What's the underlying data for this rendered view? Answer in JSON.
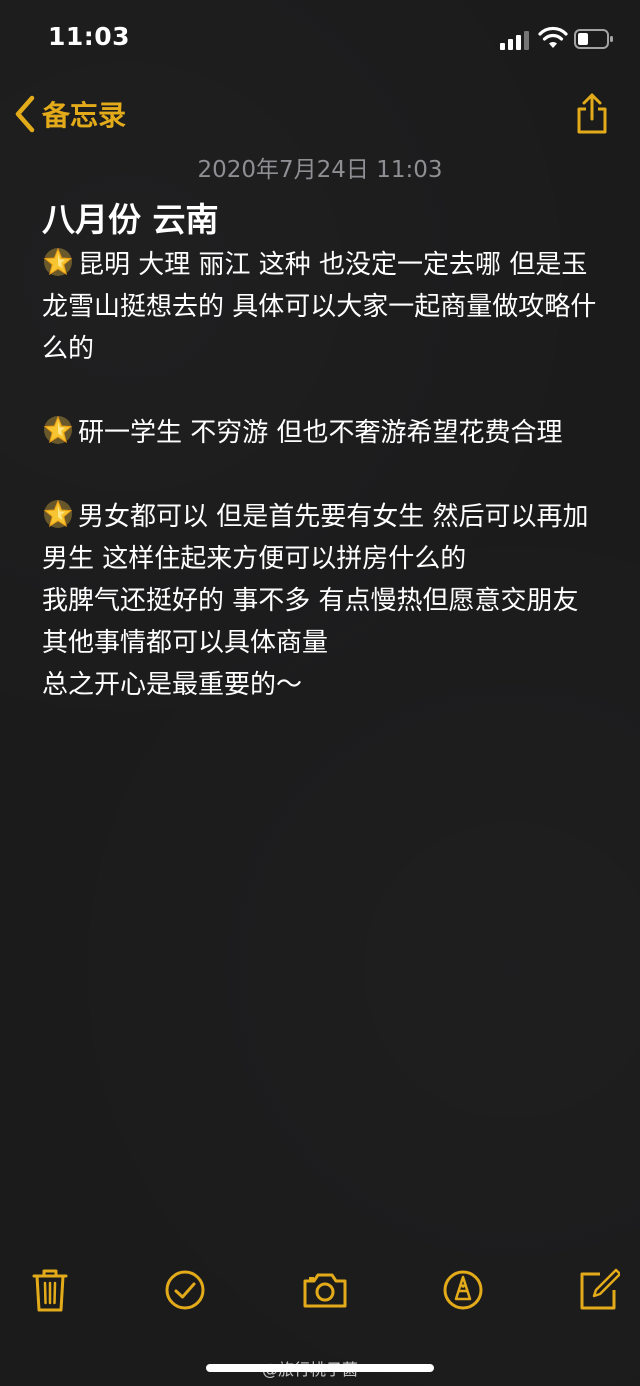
{
  "status_bar": {
    "time": "11:03"
  },
  "nav": {
    "back_label": "备忘录"
  },
  "note": {
    "date": "2020年7月24日 11:03",
    "title": "八月份 云南",
    "paragraphs": [
      "昆明 大理 丽江 这种 也没定一定去哪 但是玉龙雪山挺想去的 具体可以大家一起商量做攻略什么的",
      "研一学生 不穷游 但也不奢游希望花费合理",
      "男女都可以 但是首先要有女生 然后可以再加男生 这样住起来方便可以拼房什么的",
      "我脾气还挺好的 事不多 有点慢热但愿意交朋友",
      "其他事情都可以具体商量",
      "总之开心是最重要的～"
    ],
    "star_icon": "glowing-star-icon"
  },
  "toolbar": {
    "icons": [
      "trash-icon",
      "checklist-icon",
      "camera-icon",
      "markup-icon",
      "compose-icon"
    ]
  },
  "watermark": {
    "text": "@旅行桃子菌"
  },
  "colors": {
    "accent": "#e3ab1a",
    "background": "#1b1b1c",
    "date_text": "#8e8e93",
    "text": "#ffffff"
  }
}
